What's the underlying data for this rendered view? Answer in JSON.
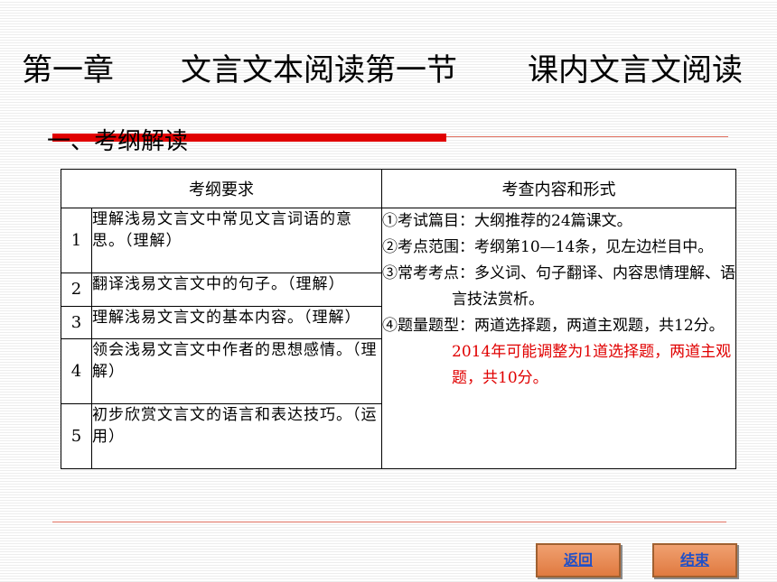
{
  "title": {
    "chapter": "第一章",
    "section": "文言文本阅读第一节",
    "topic": "课内文言文阅读"
  },
  "section_heading": "一、考纲解读",
  "table": {
    "headers": [
      "考纲要求",
      "考查内容和形式"
    ],
    "rows": [
      {
        "num": "1",
        "text": "理解浅易文言文中常见文言词语的意思。（理解）"
      },
      {
        "num": "2",
        "text": "翻译浅易文言文中的句子。（理解）"
      },
      {
        "num": "3",
        "text": "理解浅易文言文的基本内容。（理解）"
      },
      {
        "num": "4",
        "text": "领会浅易文言文中作者的思想感情。（理解）"
      },
      {
        "num": "5",
        "text": "初步欣赏文言文的语言和表达技巧。（运用）"
      }
    ],
    "content": {
      "p1": "①考试篇目：大纲推荐的24篇课文。",
      "p2": "②考点范围：考纲第10—14条，见左边栏目中。",
      "p3": "③常考考点：多义词、句子翻译、内容思情理解、语言技法赏析。",
      "p4_black": "④题量题型：两道选择题，两道主观题，共12分。",
      "p4_red": "2014年可能调整为1道选择题，两道主观题，共10分。"
    }
  },
  "nav": {
    "back_label": "返回",
    "end_label": "结束"
  },
  "colors": {
    "accent_red": "#e00000",
    "button_orange": "#e07a40",
    "link_blue": "#2050c8"
  }
}
